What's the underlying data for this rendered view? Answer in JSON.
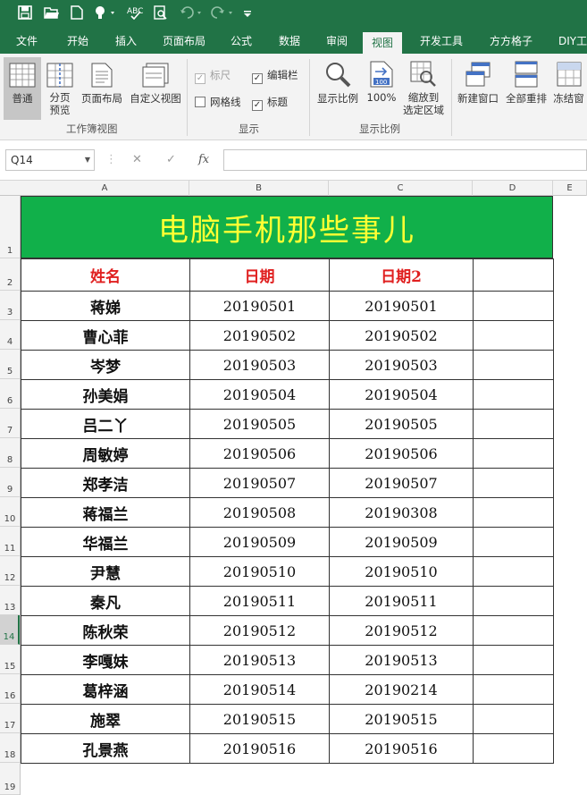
{
  "qat": {
    "icons": [
      "save-icon",
      "open-icon",
      "new-icon",
      "touch-mode-icon",
      "spellcheck-icon",
      "print-preview-icon",
      "undo-icon",
      "redo-icon",
      "customize-icon"
    ]
  },
  "tabs": [
    "文件",
    "开始",
    "插入",
    "页面布局",
    "公式",
    "数据",
    "审阅",
    "视图",
    "开发工具",
    "方方格子",
    "DIY工"
  ],
  "active_tab": "视图",
  "ribbon": {
    "workbook_views": {
      "normal": "普通",
      "page_break_line1": "分页",
      "page_break_line2": "预览",
      "page_layout": "页面布局",
      "custom_views": "自定义视图",
      "group_label": "工作簿视图"
    },
    "show": {
      "ruler": "标尺",
      "formula_bar": "编辑栏",
      "gridlines": "网格线",
      "headings": "标题",
      "group_label": "显示",
      "checks": {
        "ruler": true,
        "formula_bar": true,
        "gridlines": false,
        "headings": true
      }
    },
    "zoom": {
      "zoom": "显示比例",
      "hundred": "100%",
      "to_selection_line1": "缩放到",
      "to_selection_line2": "选定区域",
      "group_label": "显示比例"
    },
    "window": {
      "new_window": "新建窗口",
      "arrange_all": "全部重排",
      "freeze_panes": "冻结窗"
    }
  },
  "formula_bar": {
    "name_box": "Q14",
    "cancel": "✕",
    "enter": "✓",
    "fx": "fx",
    "value": ""
  },
  "columns": [
    "A",
    "B",
    "C",
    "D",
    "E"
  ],
  "rows": [
    "1",
    "2",
    "3",
    "4",
    "5",
    "6",
    "7",
    "8",
    "9",
    "10",
    "11",
    "12",
    "13",
    "14",
    "15",
    "16",
    "17",
    "18",
    "19"
  ],
  "selected_row": "14",
  "sheet": {
    "title": "电脑手机那些事儿",
    "title_bg": "#11b04a",
    "title_color": "#ffff33",
    "header_color": "#e02020",
    "headers": [
      "姓名",
      "日期",
      "日期2"
    ],
    "records": [
      [
        "蒋娣",
        "20190501",
        "20190501"
      ],
      [
        "曹心菲",
        "20190502",
        "20190502"
      ],
      [
        "岑梦",
        "20190503",
        "20190503"
      ],
      [
        "孙美娟",
        "20190504",
        "20190504"
      ],
      [
        "吕二丫",
        "20190505",
        "20190505"
      ],
      [
        "周敏婷",
        "20190506",
        "20190506"
      ],
      [
        "郑孝洁",
        "20190507",
        "20190507"
      ],
      [
        "蒋福兰",
        "20190508",
        "20190308"
      ],
      [
        "华福兰",
        "20190509",
        "20190509"
      ],
      [
        "尹慧",
        "20190510",
        "20190510"
      ],
      [
        "秦凡",
        "20190511",
        "20190511"
      ],
      [
        "陈秋荣",
        "20190512",
        "20190512"
      ],
      [
        "李嘎妹",
        "20190513",
        "20190513"
      ],
      [
        "葛梓涵",
        "20190514",
        "20190214"
      ],
      [
        "施翠",
        "20190515",
        "20190515"
      ],
      [
        "孔景燕",
        "20190516",
        "20190516"
      ]
    ]
  }
}
